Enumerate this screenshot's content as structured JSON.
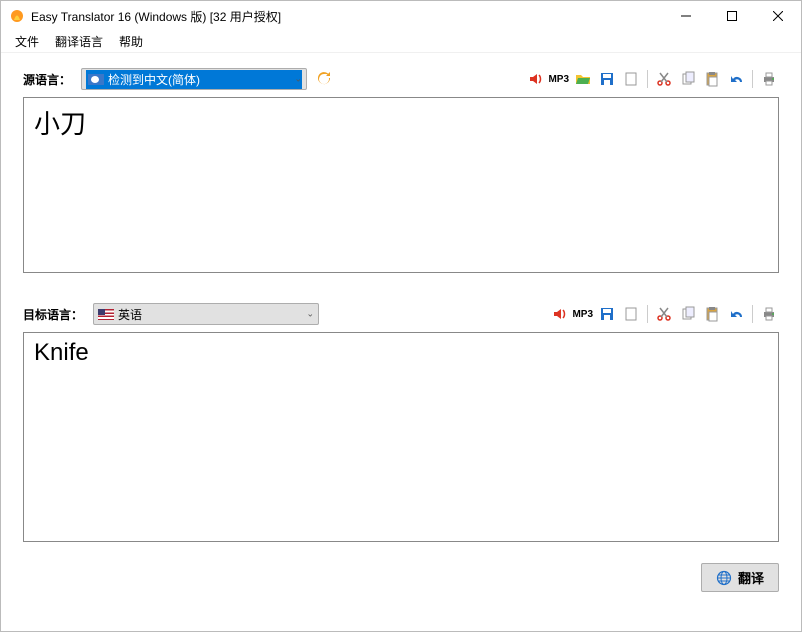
{
  "window": {
    "title": "Easy Translator 16 (Windows 版) [32 用户授权]"
  },
  "menu": {
    "file": "文件",
    "translate_language": "翻译语言",
    "help": "帮助"
  },
  "source": {
    "label": "源语言：",
    "selected": "检测到中文(简体)",
    "text": "小刀"
  },
  "target": {
    "label": "目标语言：",
    "selected": "英语",
    "text": "Knife"
  },
  "toolbar": {
    "mp3": "MP3"
  },
  "translate_button": "翻译"
}
